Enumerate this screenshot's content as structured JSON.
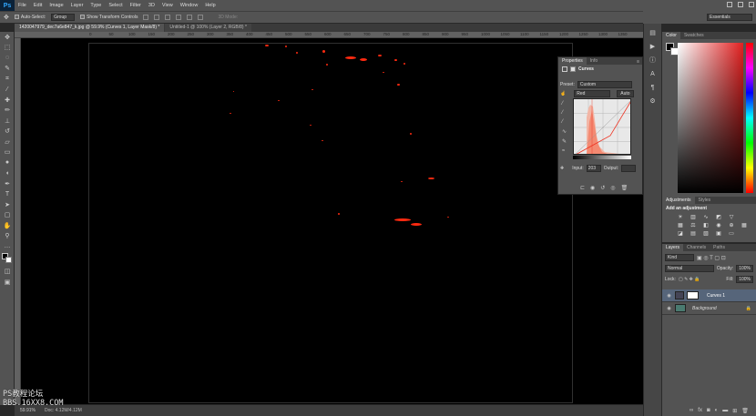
{
  "app": {
    "logo": "Ps"
  },
  "menu": [
    "File",
    "Edit",
    "Image",
    "Layer",
    "Type",
    "Select",
    "Filter",
    "3D",
    "View",
    "Window",
    "Help"
  ],
  "options": {
    "auto_select_label": "Auto-Select:",
    "auto_select_value": "Group",
    "transform_label": "Show Transform Controls",
    "mode_3d": "3D Mode:",
    "workspace": "Essentials"
  },
  "tabs": [
    {
      "label": "1420047979_dec7a6e847_k.jpg @ 59.9% (Curves 1, Layer Mask/8) *",
      "active": true
    },
    {
      "label": "Untitled-1 @ 100% (Layer 2, RGB/8) *",
      "active": false
    }
  ],
  "ruler": [
    "0",
    "50",
    "100",
    "150",
    "200",
    "250",
    "300",
    "350",
    "400",
    "450",
    "500",
    "550",
    "600",
    "650",
    "700",
    "750",
    "800",
    "850",
    "900",
    "950",
    "1000",
    "1050",
    "1100",
    "1150",
    "1200",
    "1250",
    "1300",
    "1350",
    "1400",
    "1450",
    "1500",
    "1550",
    "1600",
    "1650",
    "1700",
    "1750",
    "1800",
    "1850",
    "1900"
  ],
  "status": {
    "zoom": "59.91%",
    "info": "Doc: 4.12M/4.12M"
  },
  "watermark": {
    "line1": "PS教程论坛",
    "line2": "BBS.16XX8.COM"
  },
  "properties": {
    "tabs": [
      "Properties",
      "Info"
    ],
    "title": "Curves",
    "preset_label": "Preset:",
    "preset_value": "Custom",
    "channel": "Red",
    "auto_label": "Auto",
    "input_label": "Input:",
    "input_value": "203",
    "output_label": "Output:",
    "output_value": ""
  },
  "color_panel": {
    "tabs": [
      "Color",
      "Swatches"
    ]
  },
  "adjustments": {
    "tabs": [
      "Adjustments",
      "Styles"
    ],
    "heading": "Add an adjustment"
  },
  "layers_panel": {
    "tabs": [
      "Layers",
      "Channels",
      "Paths"
    ],
    "kind": "Kind",
    "blend": "Normal",
    "opacity_label": "Opacity:",
    "opacity_value": "100%",
    "lock_label": "Lock:",
    "fill_label": "Fill:",
    "fill_value": "100%",
    "layers": [
      {
        "name": "Curves 1",
        "selected": true
      },
      {
        "name": "Background",
        "selected": false
      }
    ]
  },
  "colors": {
    "accent_red": "#ff2a10",
    "selected_layer": "#56657a"
  }
}
